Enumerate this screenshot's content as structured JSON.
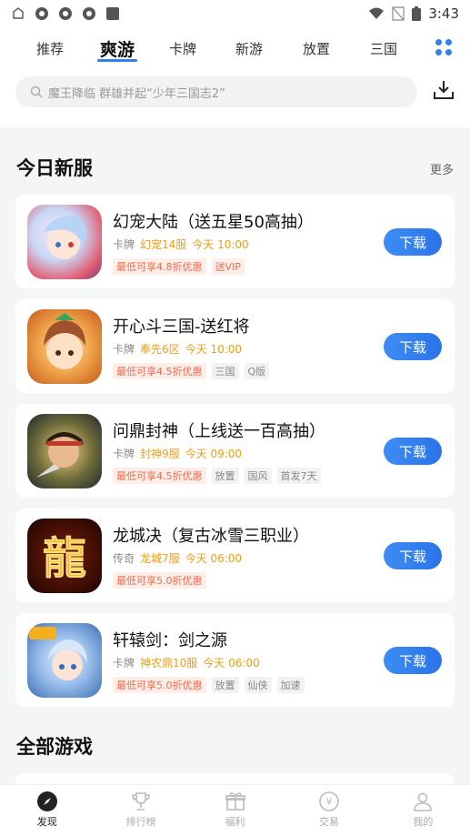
{
  "status_bar": {
    "time": "3:43"
  },
  "tabs": [
    {
      "label": "推荐",
      "active": false
    },
    {
      "label": "爽游",
      "active": true
    },
    {
      "label": "卡牌",
      "active": false
    },
    {
      "label": "新游",
      "active": false
    },
    {
      "label": "放置",
      "active": false
    },
    {
      "label": "三国",
      "active": false
    }
  ],
  "search": {
    "placeholder": "魔王降临 群雄并起“少年三国志2”"
  },
  "today_section": {
    "title": "今日新服",
    "more": "更多"
  },
  "games": [
    {
      "name": "幻宠大陆（送五星50高抽）",
      "category": "卡牌",
      "server": "幻宠14服",
      "time": "今天 10:00",
      "tags": [
        "最低可享4.8折优惠",
        "送VIP"
      ],
      "button": "下载"
    },
    {
      "name": "开心斗三国-送红将",
      "category": "卡牌",
      "server": "奉先6区",
      "time": "今天 10:00",
      "tags": [
        "最低可享4.5折优惠",
        "三国",
        "Q版"
      ],
      "button": "下载"
    },
    {
      "name": "问鼎封神（上线送一百高抽）",
      "category": "卡牌",
      "server": "封神9服",
      "time": "今天 09:00",
      "tags": [
        "最低可享4.5折优惠",
        "放置",
        "国风",
        "首发7天"
      ],
      "button": "下载"
    },
    {
      "name": "龙城决（复古冰雪三职业）",
      "category": "传奇",
      "server": "龙城7服",
      "time": "今天 06:00",
      "tags": [
        "最低可享5.0折优惠"
      ],
      "button": "下载"
    },
    {
      "name": "轩辕剑：剑之源",
      "category": "卡牌",
      "server": "神农鼎10服",
      "time": "今天 06:00",
      "tags": [
        "最低可享5.0折优惠",
        "放置",
        "仙侠",
        "加速"
      ],
      "button": "下载"
    }
  ],
  "all_section": {
    "title": "全部游戏"
  },
  "bottom_nav": [
    {
      "label": "发现",
      "icon": "compass-icon",
      "active": true
    },
    {
      "label": "排行榜",
      "icon": "trophy-icon",
      "active": false
    },
    {
      "label": "福利",
      "icon": "gift-icon",
      "active": false
    },
    {
      "label": "交易",
      "icon": "exchange-icon",
      "active": false
    },
    {
      "label": "我的",
      "icon": "user-icon",
      "active": false
    }
  ],
  "colors": {
    "accent": "#2f80ed",
    "server": "#f39c12",
    "discount": "#f26b4d"
  }
}
